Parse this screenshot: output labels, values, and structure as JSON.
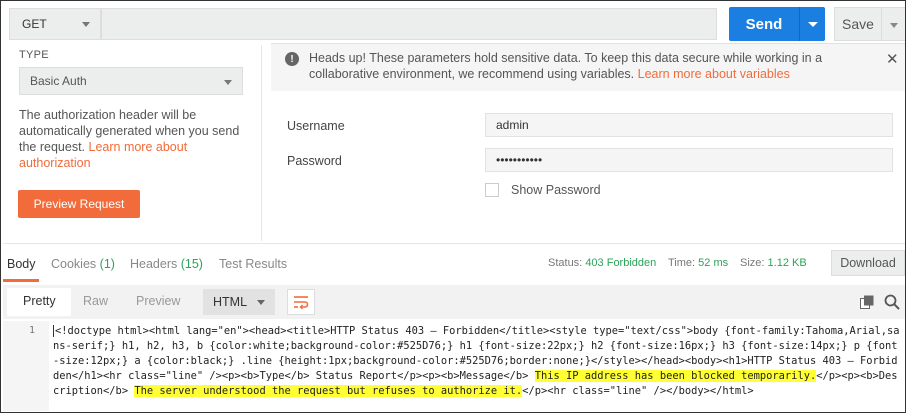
{
  "request": {
    "method": "GET",
    "url": "",
    "send_label": "Send",
    "save_label": "Save"
  },
  "auth": {
    "type_label": "TYPE",
    "type_value": "Basic Auth",
    "desc": "The authorization header will be automatically generated when you send the request.",
    "desc_link": "Learn more about authorization",
    "preview_label": "Preview Request"
  },
  "warning": {
    "text": "Heads up! These parameters hold sensitive data. To keep this data secure while working in a collaborative environment, we recommend using variables.",
    "link": "Learn more about variables"
  },
  "form": {
    "username_label": "Username",
    "username_value": "admin",
    "password_label": "Password",
    "password_value": "•••••••••••",
    "show_password_label": "Show Password"
  },
  "response_tabs": {
    "body": "Body",
    "cookies": "Cookies",
    "cookies_count": "(1)",
    "headers": "Headers",
    "headers_count": "(15)",
    "tests": "Test Results"
  },
  "status": {
    "status_label": "Status:",
    "status_value": "403 Forbidden",
    "time_label": "Time:",
    "time_value": "52 ms",
    "size_label": "Size:",
    "size_value": "1.12 KB",
    "download_label": "Download"
  },
  "view": {
    "pretty": "Pretty",
    "raw": "Raw",
    "preview": "Preview",
    "format": "HTML"
  },
  "code": {
    "line_number": "1",
    "part1": "<!doctype html><html lang=\"en\"><head><title>HTTP Status 403 – Forbidden</title><style type=\"text/css\">body {font-family:Tahoma,Arial,sans-serif;} h1, h2, h3, b {color:white;background-color:#525D76;} h1 {font-size:22px;} h2 {font-size:16px;} h3 {font-size:14px;} p {font-size:12px;} a {color:black;} .line {height:1px;background-color:#525D76;border:none;}</style></head><body><h1>HTTP Status 403 – Forbidden</h1><hr class=\"line\" /><p><b>Type</b> Status Report</p><p><b>Message</b> ",
    "highlight1": "This IP address has been blocked temporarily.",
    "part2": "</p><p><b>Description</b> ",
    "highlight2": "The server understood the request but refuses to authorize it.",
    "part3": "</p><hr class=\"line\" /></body></html>"
  },
  "colors": {
    "accent": "#f26b3a",
    "primary": "#1a7fe0",
    "status_ok": "#2aa35a",
    "highlight": "#ffff33"
  }
}
